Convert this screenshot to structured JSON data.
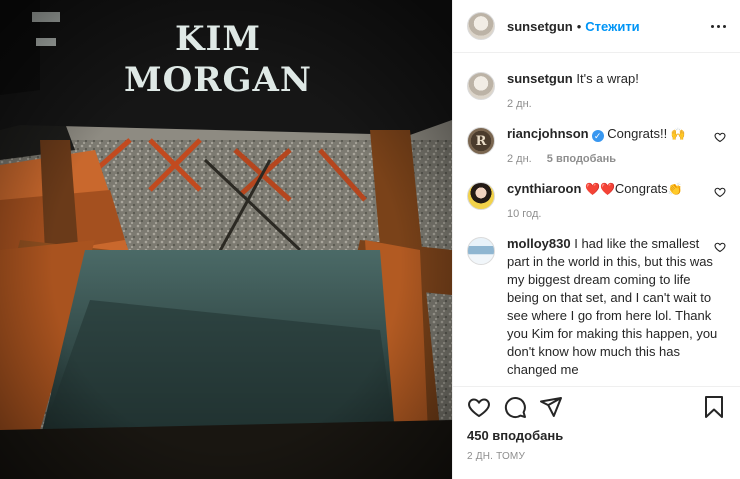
{
  "post": {
    "author": "sunsetgun",
    "separator": "•",
    "follow_label": "Стежити",
    "photo_text": {
      "line1": "KIM",
      "line2": "MORGAN"
    }
  },
  "caption": {
    "user": "sunsetgun",
    "text": "It's a wrap!",
    "time": "2 дн."
  },
  "comments": [
    {
      "user": "riancjohnson",
      "verified": true,
      "text": "Congrats!!",
      "emoji": "🙌",
      "time": "2 дн.",
      "likes": "5 вподобань",
      "avatar_letter": "R"
    },
    {
      "user": "cynthiaroon",
      "prefix_emoji": "❤️❤️",
      "text": "Congrats",
      "emoji": "👏",
      "time": "10 год."
    },
    {
      "user": "molloy830",
      "text": "I had like the smallest part in the world in this, but this was my biggest dream coming to life being on that set, and I can't wait to see where I go from here lol. Thank you Kim for making this happen, you don't know how much this has changed me"
    }
  ],
  "footer": {
    "likes_total": "450 вподобань",
    "posted_ago": "2 ДН. ТОМУ"
  },
  "icons": [
    "more-icon",
    "heart-icon",
    "comment-icon",
    "share-icon",
    "bookmark-icon"
  ],
  "colors": {
    "accent": "#0095f6",
    "secondary_text": "#8e8e8e",
    "border": "#efefef"
  }
}
